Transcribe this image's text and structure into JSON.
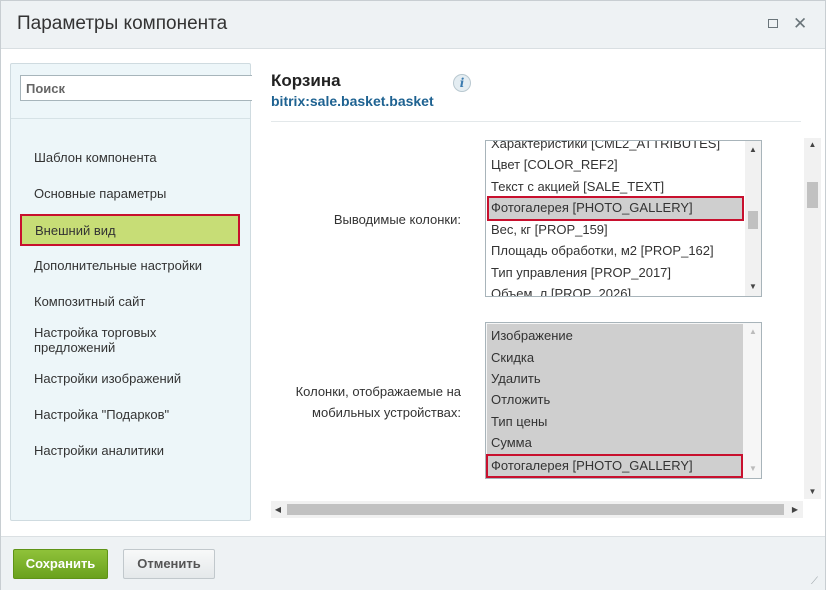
{
  "window": {
    "title": "Параметры компонента",
    "maximize_icon": "maximize-icon",
    "close_icon": "close-icon",
    "close_glyph": "✕"
  },
  "sidebar": {
    "search_placeholder": "Поиск",
    "items": [
      {
        "label": "Шаблон компонента"
      },
      {
        "label": "Основные параметры"
      },
      {
        "label": "Внешний вид",
        "active": true
      },
      {
        "label": "Дополнительные настройки"
      },
      {
        "label": "Композитный сайт"
      },
      {
        "label": "Настройка торговых предложений"
      },
      {
        "label": "Настройки изображений"
      },
      {
        "label": "Настройка \"Подарков\""
      },
      {
        "label": "Настройки аналитики"
      }
    ]
  },
  "component": {
    "title": "Корзина",
    "code": "bitrix:sale.basket.basket",
    "info_glyph": "i"
  },
  "fields": {
    "columns": {
      "label": "Выводимые колонки:",
      "options": [
        "Характеристики [CML2_ATTRIBUTES]",
        "Цвет [COLOR_REF2]",
        "Текст с акцией [SALE_TEXT]",
        "Фотогалерея [PHOTO_GALLERY]",
        "Вес, кг [PROP_159]",
        "Площадь обработки, м2 [PROP_162]",
        "Тип управления [PROP_2017]",
        "Объем, л [PROP_2026]"
      ],
      "selected": [
        "Фотогалерея [PHOTO_GALLERY]"
      ]
    },
    "mobile_columns": {
      "label_line1": "Колонки, отображаемые на",
      "label_line2": "мобильных устройствах:",
      "options": [
        "Изображение",
        "Скидка",
        "Удалить",
        "Отложить",
        "Тип цены",
        "Сумма",
        "Фотогалерея [PHOTO_GALLERY]"
      ],
      "selected": [
        "Изображение",
        "Скидка",
        "Удалить",
        "Отложить",
        "Тип цены",
        "Сумма",
        "Фотогалерея [PHOTO_GALLERY]"
      ]
    }
  },
  "footer": {
    "save_label": "Сохранить",
    "cancel_label": "Отменить"
  },
  "colors": {
    "save_button": "#78ad25",
    "active_item": "#c7dd76",
    "highlight_border": "#c8102e",
    "link": "#1e6291"
  }
}
